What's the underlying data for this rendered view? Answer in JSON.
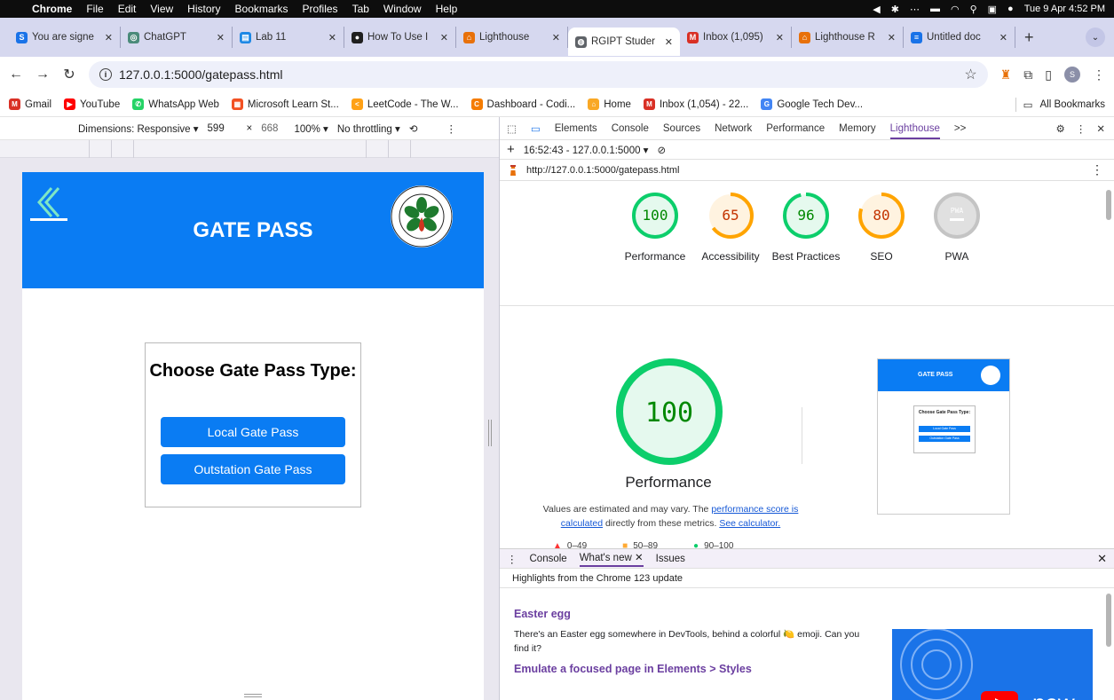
{
  "menubar": {
    "app": "Chrome",
    "items": [
      "File",
      "Edit",
      "View",
      "History",
      "Bookmarks",
      "Profiles",
      "Tab",
      "Window",
      "Help"
    ],
    "clock": "Tue 9 Apr  4:52 PM"
  },
  "tabs": [
    {
      "title": "You are signe",
      "icon": "s-icon",
      "color": "#1a73e8",
      "glyph": "S"
    },
    {
      "title": "ChatGPT",
      "icon": "chatgpt-icon",
      "color": "#4b8b7a",
      "glyph": "◎"
    },
    {
      "title": "Lab 11",
      "icon": "classroom-icon",
      "color": "#1e88e5",
      "glyph": "▤"
    },
    {
      "title": "How To Use I",
      "icon": "circle-icon",
      "color": "#1f1f1f",
      "glyph": "●"
    },
    {
      "title": "Lighthouse",
      "icon": "lighthouse-icon",
      "color": "#e8710a",
      "glyph": "⌂"
    },
    {
      "title": "RGIPT Studer",
      "icon": "globe-icon",
      "color": "#5f6368",
      "glyph": "◍",
      "active": true
    },
    {
      "title": "Inbox (1,095)",
      "icon": "gmail-icon",
      "color": "#d93025",
      "glyph": "M"
    },
    {
      "title": "Lighthouse R",
      "icon": "lighthouse-icon",
      "color": "#e8710a",
      "glyph": "⌂"
    },
    {
      "title": "Untitled doc",
      "icon": "docs-icon",
      "color": "#1a73e8",
      "glyph": "≡"
    }
  ],
  "address": {
    "url": "127.0.0.1:5000/gatepass.html"
  },
  "bookmarks": [
    {
      "label": "Gmail",
      "color": "#d93025",
      "glyph": "M"
    },
    {
      "label": "YouTube",
      "color": "#ff0000",
      "glyph": "▶"
    },
    {
      "label": "WhatsApp Web",
      "color": "#25d366",
      "glyph": "✆"
    },
    {
      "label": "Microsoft Learn St...",
      "color": "#f25022",
      "glyph": "▦"
    },
    {
      "label": "LeetCode - The W...",
      "color": "#ffa116",
      "glyph": "<"
    },
    {
      "label": "Dashboard - Codi...",
      "color": "#f57c00",
      "glyph": "C"
    },
    {
      "label": "Home",
      "color": "#f9a825",
      "glyph": "⌂"
    },
    {
      "label": "Inbox (1,054) - 22...",
      "color": "#d93025",
      "glyph": "M"
    },
    {
      "label": "Google Tech Dev...",
      "color": "#4285f4",
      "glyph": "G"
    }
  ],
  "all_bookmarks": "All Bookmarks",
  "device_toolbar": {
    "dimensions": "Dimensions: Responsive ▾",
    "width": "599",
    "height": "668",
    "zoom": "100% ▾",
    "throttle": "No throttling ▾"
  },
  "gatepass": {
    "title": "GATE PASS",
    "heading": "Choose Gate Pass Type:",
    "local_btn": "Local Gate Pass",
    "outstation_btn": "Outstation Gate Pass",
    "header_color": "#0a7cf3"
  },
  "devtools": {
    "tabs": [
      "Elements",
      "Console",
      "Sources",
      "Network",
      "Performance",
      "Memory",
      "Lighthouse"
    ],
    "active_tab": "Lighthouse",
    "more": ">>",
    "report_select": "16:52:43 - 127.0.0.1:5000 ▾",
    "report_url": "http://127.0.0.1:5000/gatepass.html"
  },
  "lighthouse": {
    "scores": [
      {
        "label": "Performance",
        "value": "100",
        "score": 100,
        "status": "pass"
      },
      {
        "label": "Accessibility",
        "value": "65",
        "score": 65,
        "status": "average"
      },
      {
        "label": "Best Practices",
        "value": "96",
        "score": 96,
        "status": "pass"
      },
      {
        "label": "SEO",
        "value": "80",
        "score": 80,
        "status": "average"
      },
      {
        "label": "PWA",
        "value": "PWA",
        "score": null,
        "status": "na"
      }
    ],
    "big_score": "100",
    "big_title": "Performance",
    "note_prefix": "Values are estimated and may vary. The ",
    "note_link1": "performance score is calculated",
    "note_mid": " directly from these metrics. ",
    "note_link2": "See calculator.",
    "legend": [
      {
        "label": "0–49",
        "color": "#ff3333",
        "shape": "triangle"
      },
      {
        "label": "50–89",
        "color": "#ffaa33",
        "shape": "square"
      },
      {
        "label": "90–100",
        "color": "#0cce6b",
        "shape": "circle"
      }
    ],
    "thumb_title": "GATE PASS",
    "thumb_heading": "Choose Gate Pass Type:",
    "thumb_btn1": "Local Gate Pass",
    "thumb_btn2": "Outstation Gate Pass",
    "colors": {
      "pass": "#0cce6b",
      "average": "#ffa400",
      "na": "#c4c4c4"
    }
  },
  "drawer": {
    "tabs": [
      "Console",
      "What's new",
      "Issues"
    ],
    "active": "What's new",
    "highlights": "Highlights from the Chrome 123 update",
    "h1": "Easter egg",
    "p1": "There's an Easter egg somewhere in DevTools, behind a colorful 🍋 emoji. Can you find it?",
    "h2": "Emulate a focused page in Elements > Styles",
    "video_label": "new"
  }
}
